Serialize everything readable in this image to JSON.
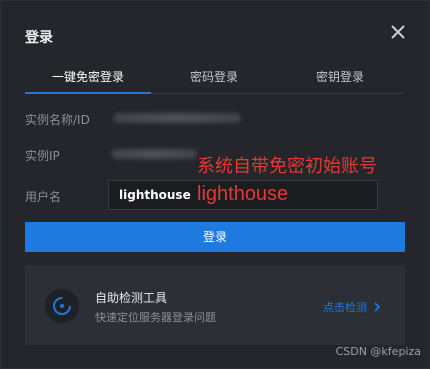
{
  "dialog": {
    "title": "登录",
    "close_icon": "close-icon"
  },
  "tabs": [
    {
      "label": "一键免密登录",
      "active": true
    },
    {
      "label": "密码登录",
      "active": false
    },
    {
      "label": "密钥登录",
      "active": false
    }
  ],
  "fields": {
    "instance_label": "实例名称/ID",
    "ip_label": "实例IP",
    "username_label": "用户名",
    "username_value": "lighthouse"
  },
  "annotations": {
    "note_line1": "系统自带免密初始账号",
    "note_line2": "lighthouse"
  },
  "buttons": {
    "login": "登录"
  },
  "tool": {
    "title": "自助检测工具",
    "subtitle": "快速定位服务器登录问题",
    "link": "点击检测"
  },
  "watermark": "CSDN @kfepiza",
  "colors": {
    "accent": "#1f7ae0",
    "annotation": "#e53935",
    "background": "#24262b"
  }
}
